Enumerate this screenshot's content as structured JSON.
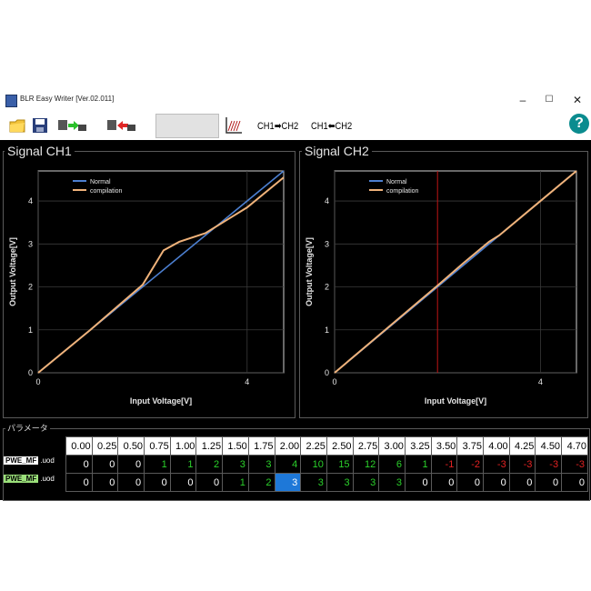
{
  "window": {
    "title": "BLR Easy Writer [Ver.02.011]",
    "minimize": "–",
    "maximize": "☐",
    "close": "✕"
  },
  "toolbar": {
    "ch1_to_ch2": "CH1➡CH2",
    "ch2_to_ch1": "CH1⬅CH2",
    "help": "?"
  },
  "icons": [
    "open-folder-icon",
    "save-icon",
    "write-to-device-icon",
    "read-from-device-icon",
    "graph-icon",
    "help-icon"
  ],
  "colors": {
    "normal_line": "#4c7fd0",
    "compilation_line": "#efb27a",
    "green_value": "#2bd12b",
    "red_value": "#e22222",
    "selected": "#1e78d8"
  },
  "params": {
    "title": "パラメータ",
    "columns": [
      "0.00",
      "0.25",
      "0.50",
      "0.75",
      "1.00",
      "1.25",
      "1.50",
      "1.75",
      "2.00",
      "2.25",
      "2.50",
      "2.75",
      "3.00",
      "3.25",
      "3.50",
      "3.75",
      "4.00",
      "4.25",
      "4.50",
      "4.70"
    ],
    "rows": [
      {
        "label": "PWE_MF",
        "suffix": ".uod",
        "values": [
          "0",
          "0",
          "0",
          "1",
          "1",
          "2",
          "3",
          "3",
          "4",
          "10",
          "15",
          "12",
          "6",
          "1",
          "-1",
          "-2",
          "-3",
          "-3",
          "-3",
          "-3"
        ]
      },
      {
        "label": "PWE_MF",
        "suffix": ".uod",
        "values": [
          "0",
          "0",
          "0",
          "0",
          "0",
          "0",
          "1",
          "2",
          "3",
          "3",
          "3",
          "3",
          "3",
          "0",
          "0",
          "0",
          "0",
          "0",
          "0",
          "0"
        ]
      }
    ]
  },
  "chart_data": [
    {
      "type": "line",
      "title": "Signal CH1",
      "xlabel": "Input Voltage[V]",
      "ylabel": "Output Voltage[V]",
      "xlim": [
        0,
        4.7
      ],
      "ylim": [
        0,
        4.7
      ],
      "xticks": [
        "0",
        "4"
      ],
      "yticks": [
        "0",
        "1",
        "2",
        "3",
        "4"
      ],
      "legend": "top-left",
      "series": [
        {
          "name": "Normal",
          "x": [
            0,
            4.7
          ],
          "y": [
            0,
            4.7
          ]
        },
        {
          "name": "compilation",
          "x": [
            0,
            1,
            2,
            2.4,
            2.7,
            3.2,
            4,
            4.7
          ],
          "y": [
            0,
            1,
            2.05,
            2.85,
            3.05,
            3.25,
            3.85,
            4.55
          ]
        }
      ]
    },
    {
      "type": "line",
      "title": "Signal CH2",
      "xlabel": "Input Voltage[V]",
      "ylabel": "Output Voltage[V]",
      "xlim": [
        0,
        4.7
      ],
      "ylim": [
        0,
        4.7
      ],
      "xticks": [
        "0",
        "4"
      ],
      "yticks": [
        "0",
        "1",
        "2",
        "3",
        "4"
      ],
      "legend": "top-left",
      "marker_x": 2.0,
      "series": [
        {
          "name": "Normal",
          "x": [
            0,
            4.7
          ],
          "y": [
            0,
            4.7
          ]
        },
        {
          "name": "compilation",
          "x": [
            0,
            2,
            2.5,
            3,
            3.2,
            4,
            4.7
          ],
          "y": [
            0,
            2.03,
            2.55,
            3.05,
            3.2,
            4,
            4.7
          ]
        }
      ]
    }
  ]
}
